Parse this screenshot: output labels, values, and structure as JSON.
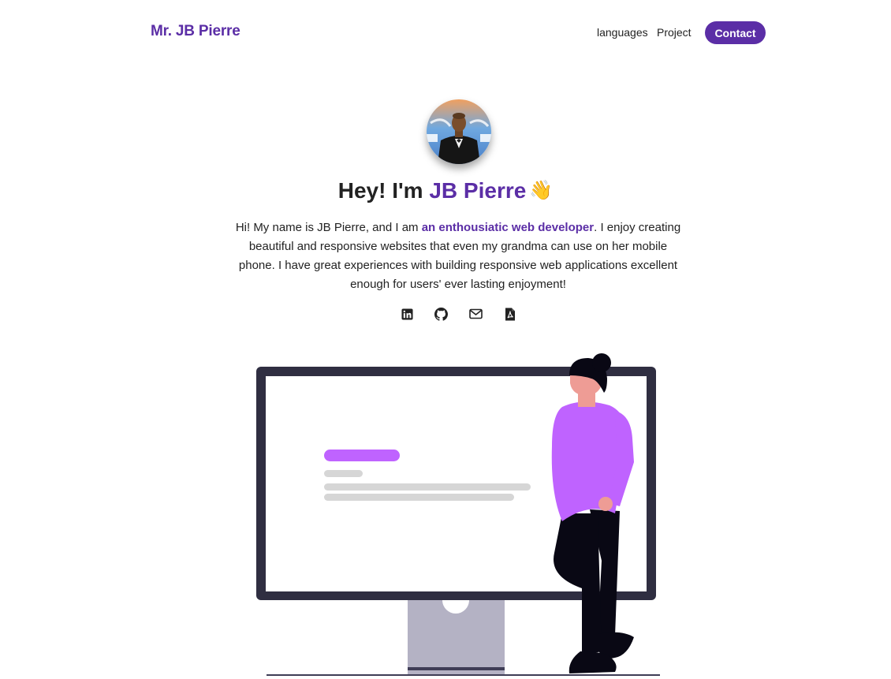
{
  "nav": {
    "logo": "Mr. JB Pierre",
    "links": [
      "languages",
      "Project"
    ],
    "contact_label": "Contact"
  },
  "hero": {
    "title_prefix": "Hey! I'm ",
    "title_name": "JB Pierre",
    "wave_emoji": "👋",
    "bio_start": "Hi! My name is JB Pierre, and I am ",
    "bio_highlight": "an enthousiatic web developer",
    "bio_end": ". I enjoy creating beautiful and responsive websites that even my grandma can use on her mobile phone. I have great experiences with building responsive web applications excellent enough for users' ever lasting enjoyment!"
  },
  "socials": [
    {
      "icon": "linkedin-icon"
    },
    {
      "icon": "github-icon"
    },
    {
      "icon": "mail-icon"
    },
    {
      "icon": "pdf-icon"
    }
  ],
  "colors": {
    "accent": "#5b2ea6",
    "illustration_purple": "#bf63ff",
    "monitor_frame": "#2f2e41",
    "monitor_stand": "#b4b2c4"
  }
}
